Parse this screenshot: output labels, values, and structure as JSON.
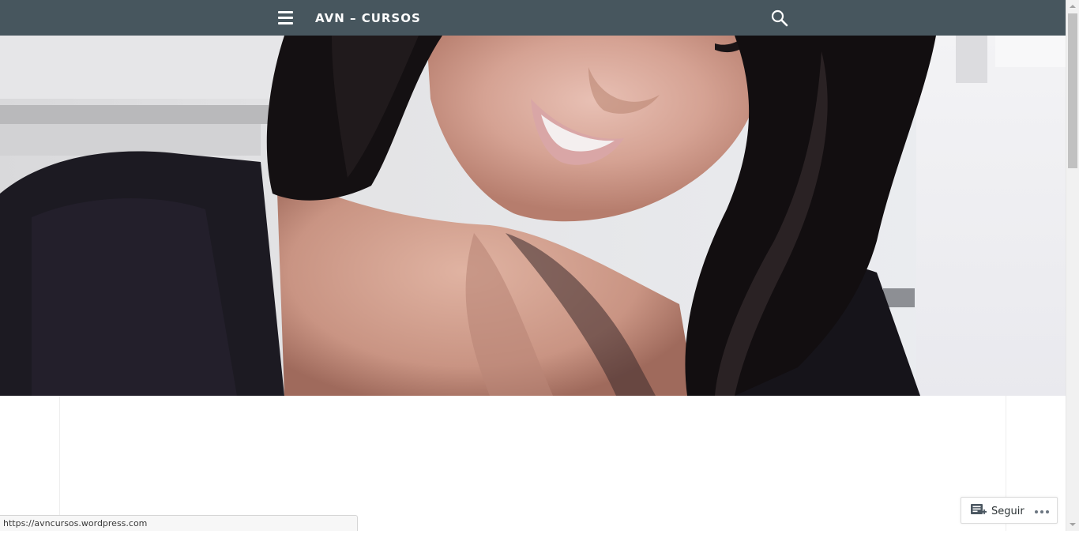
{
  "header": {
    "site_title": "AVN – CURSOS",
    "menu_icon": "hamburger-menu-icon",
    "search_icon": "search-icon",
    "background_color": "#47565e"
  },
  "hero": {
    "image_icon": "header-photo"
  },
  "follow_widget": {
    "follow_label": "Seguir",
    "follow_icon": "reader-follow-icon",
    "more_icon": "more-dots-icon"
  },
  "status_bar": {
    "url": "https://avncursos.wordpress.com"
  }
}
